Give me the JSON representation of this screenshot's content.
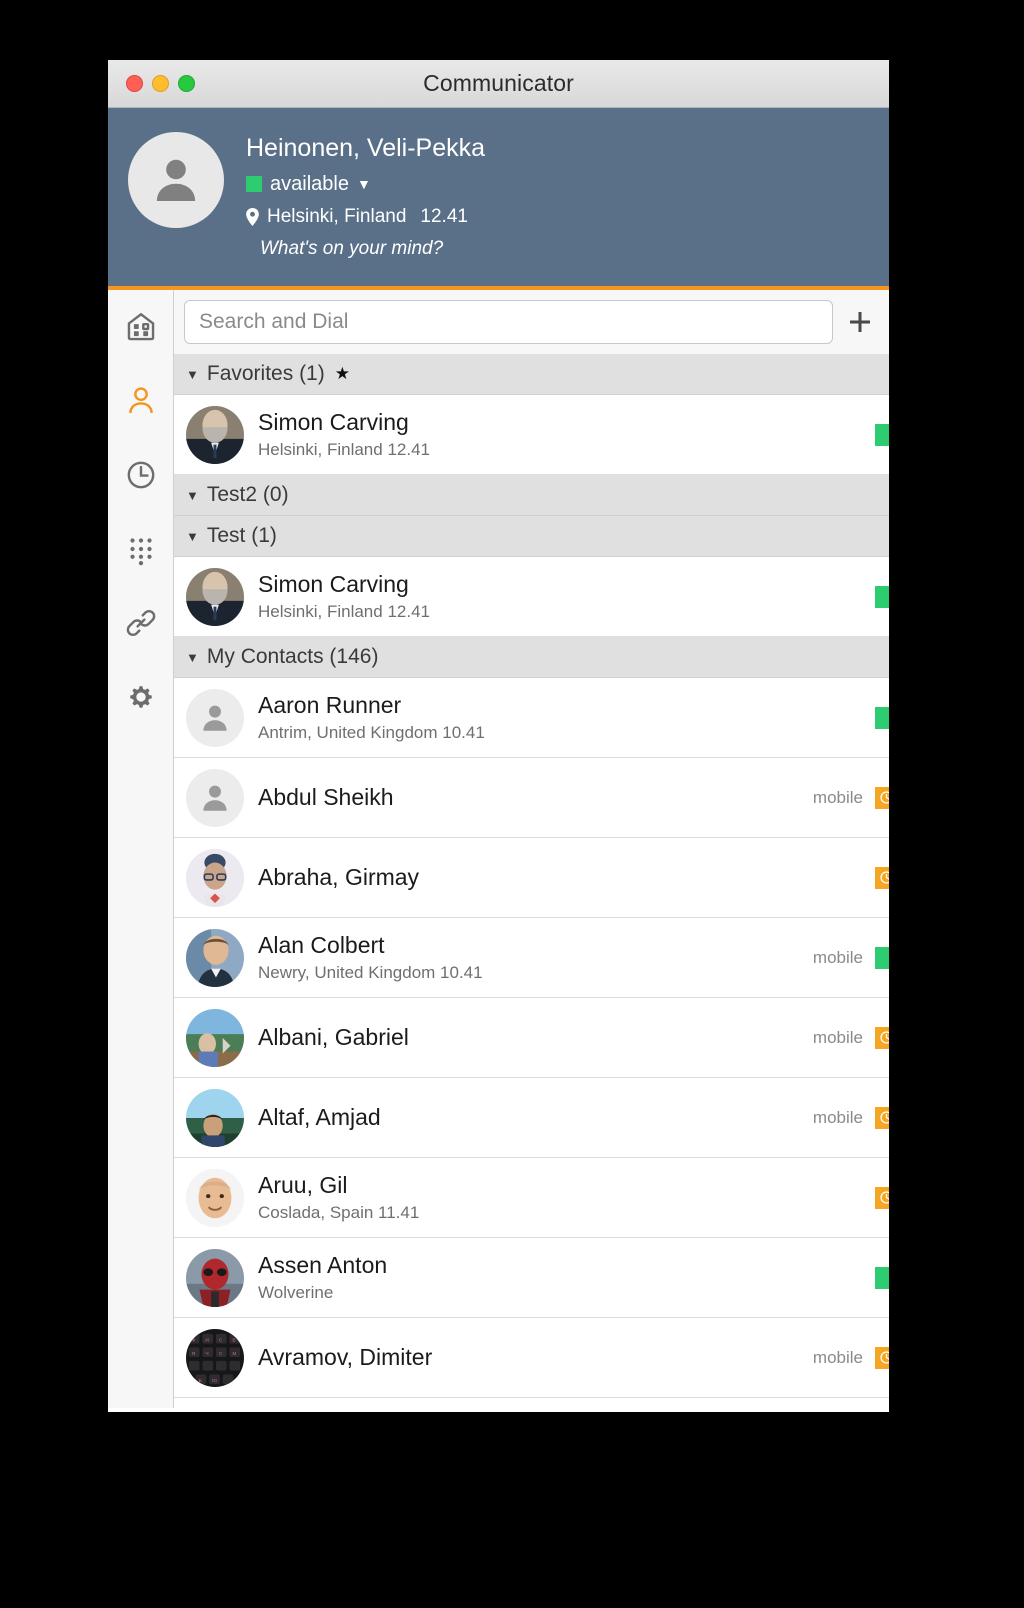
{
  "window": {
    "title": "Communicator",
    "controls": {
      "close": "close",
      "minimize": "minimize",
      "maximize": "maximize"
    }
  },
  "theme": {
    "header_bg": "#5a7089",
    "accent": "#f5941e",
    "available": "#2ecc71",
    "away": "#f5a623",
    "group_bg": "#e0e0e0"
  },
  "user": {
    "name": "Heinonen, Veli-Pekka",
    "status": "available",
    "status_caret": "▼",
    "location": "Helsinki, Finland",
    "time": "12.41",
    "mood_placeholder": "What's on your mind?"
  },
  "sidebar": {
    "items": [
      {
        "icon": "dashboard-icon",
        "name": "dashboard",
        "active": false
      },
      {
        "icon": "contacts-icon",
        "name": "contacts",
        "active": true
      },
      {
        "icon": "history-icon",
        "name": "history",
        "active": false
      },
      {
        "icon": "dialpad-icon",
        "name": "dialpad",
        "active": false
      },
      {
        "icon": "link-icon",
        "name": "link",
        "active": false
      },
      {
        "icon": "settings-icon",
        "name": "settings",
        "active": false
      }
    ]
  },
  "search": {
    "placeholder": "Search and Dial",
    "value": "",
    "add_icon": "plus-icon"
  },
  "groups": [
    {
      "label": "Favorites (1)",
      "caret": "▼",
      "star": "★",
      "contacts": [
        {
          "name": "Simon Carving",
          "subtitle": "Helsinki, Finland  12.41",
          "device": "",
          "presence": "available",
          "avatar": "photo-beard"
        }
      ]
    },
    {
      "label": "Test2 (0)",
      "caret": "▼",
      "star": "",
      "contacts": []
    },
    {
      "label": "Test (1)",
      "caret": "▼",
      "star": "",
      "contacts": [
        {
          "name": "Simon Carving",
          "subtitle": "Helsinki, Finland  12.41",
          "device": "",
          "presence": "available",
          "avatar": "photo-beard"
        }
      ]
    },
    {
      "label": "My Contacts (146)",
      "caret": "▼",
      "star": "",
      "contacts": [
        {
          "name": "Aaron Runner",
          "subtitle": "Antrim, United Kingdom  10.41",
          "device": "",
          "presence": "available",
          "avatar": "placeholder"
        },
        {
          "name": "Abdul Sheikh",
          "subtitle": "",
          "device": "mobile",
          "presence": "away",
          "avatar": "placeholder"
        },
        {
          "name": "Abraha, Girmay",
          "subtitle": "",
          "device": "",
          "presence": "away",
          "avatar": "photo-glasses"
        },
        {
          "name": "Alan Colbert",
          "subtitle": "Newry, United Kingdom  10.41",
          "device": "mobile",
          "presence": "available",
          "avatar": "photo-man"
        },
        {
          "name": "Albani, Gabriel",
          "subtitle": "",
          "device": "mobile",
          "presence": "away",
          "avatar": "photo-outdoor"
        },
        {
          "name": "Altaf, Amjad",
          "subtitle": "",
          "device": "mobile",
          "presence": "away",
          "avatar": "photo-sky"
        },
        {
          "name": "Aruu, Gil",
          "subtitle": "Coslada, Spain  11.41",
          "device": "",
          "presence": "away",
          "avatar": "photo-face"
        },
        {
          "name": "Assen Anton",
          "subtitle": "Wolverine",
          "device": "",
          "presence": "available",
          "avatar": "photo-mask"
        },
        {
          "name": "Avramov, Dimiter",
          "subtitle": "",
          "device": "mobile",
          "presence": "away",
          "avatar": "photo-keyboard"
        }
      ]
    }
  ]
}
